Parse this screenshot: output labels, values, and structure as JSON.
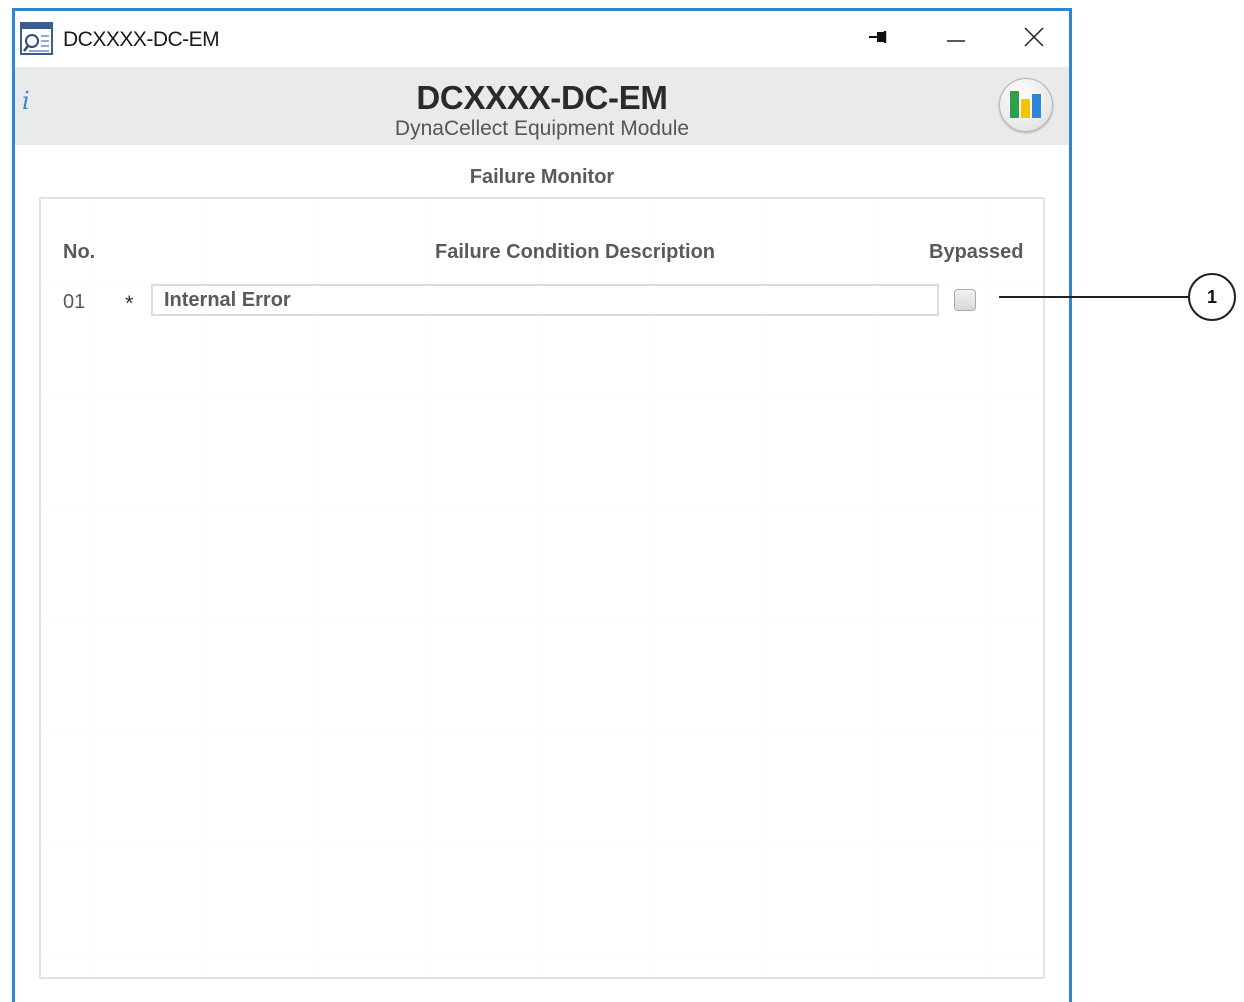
{
  "window": {
    "title": "DCXXXX-DC-EM",
    "icon": "app-document-icon",
    "controls": {
      "pin": "pin-icon",
      "minimize": "minimize-icon",
      "close": "close-icon"
    }
  },
  "header": {
    "info_label": "i",
    "title": "DCXXXX-DC-EM",
    "subtitle": "DynaCellect Equipment Module",
    "stats_icon": "bar-chart-icon"
  },
  "section": {
    "title": "Failure Monitor"
  },
  "table": {
    "columns": {
      "no": "No.",
      "description": "Failure Condition Description",
      "bypassed": "Bypassed"
    },
    "rows": [
      {
        "no": "01",
        "marker": "*",
        "description": "Internal Error",
        "bypassed": false
      }
    ]
  },
  "callout": {
    "label": "1"
  },
  "colors": {
    "window_border": "#2f86d6",
    "header_band": "#e9ebea",
    "info_icon": "#3a7fd5",
    "chart_bars": [
      "#2fa04a",
      "#f2c500",
      "#2f86d6"
    ]
  }
}
